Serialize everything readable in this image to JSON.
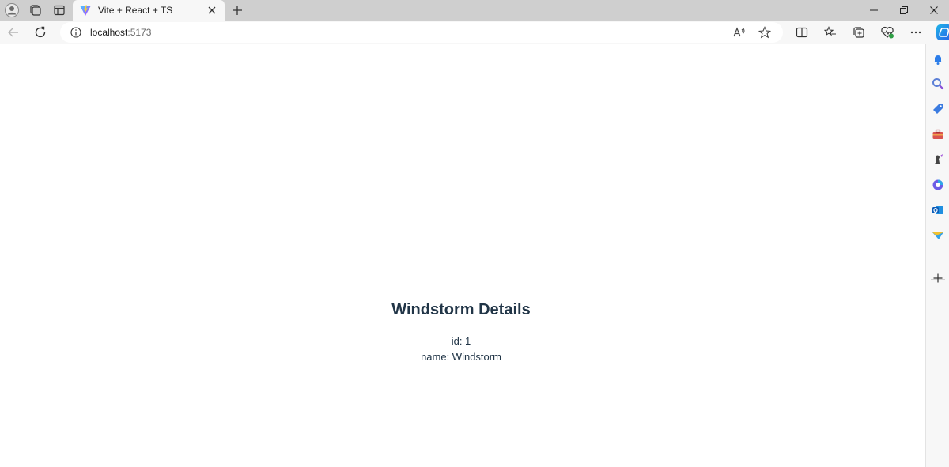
{
  "tab": {
    "title": "Vite + React + TS"
  },
  "address": {
    "host": "localhost",
    "port": ":5173"
  },
  "page": {
    "heading": "Windstorm Details",
    "id_line": "id: 1",
    "name_line": "name: Windstorm"
  },
  "colors": {
    "text": "#213547",
    "tabstrip": "#cfcfcf",
    "toolbar": "#f7f7f7",
    "copilot": "#2b7de9"
  }
}
